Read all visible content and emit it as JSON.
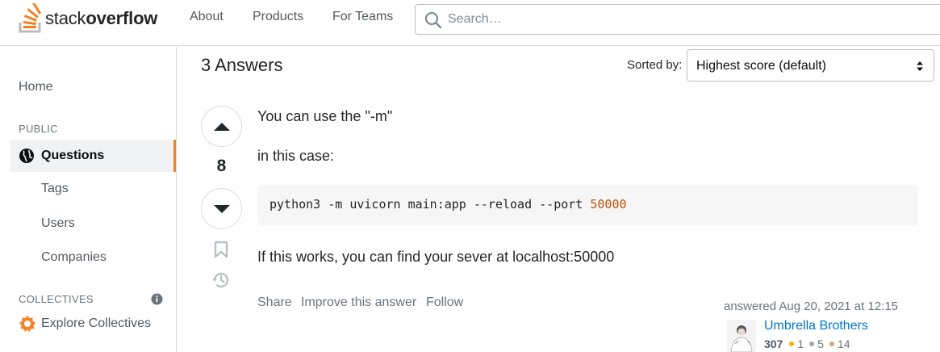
{
  "header": {
    "logo_light": "stack",
    "logo_bold": "overflow",
    "nav": [
      "About",
      "Products",
      "For Teams"
    ],
    "search_placeholder": "Search…"
  },
  "sidebar": {
    "home": "Home",
    "public_section": "PUBLIC",
    "questions": "Questions",
    "tags": "Tags",
    "users": "Users",
    "companies": "Companies",
    "collectives_section": "COLLECTIVES",
    "explore_collectives": "Explore Collectives"
  },
  "answers": {
    "header": "3 Answers",
    "sorted_by_label": "Sorted by:",
    "sort_value": "Highest score (default)"
  },
  "answer": {
    "score": "8",
    "p1": "You can use the \"-m\"",
    "p2": "in this case:",
    "code_text": "python3 -m uvicorn main:app --reload --port ",
    "code_number": "50000",
    "p3": "If this works, you can find your sever at localhost:50000",
    "menu": [
      "Share",
      "Improve this answer",
      "Follow"
    ],
    "answered_label": "answered",
    "answered_time": "Aug 20, 2021 at 12:15",
    "user_name": "Umbrella Brothers",
    "reputation": "307",
    "badges": {
      "gold": "1",
      "silver": "5",
      "bronze": "14"
    }
  },
  "colors": {
    "accent": "#f48225",
    "link": "#0074cc",
    "gold": "#f1b600",
    "silver": "#9fa6ad",
    "bronze": "#d1a684"
  }
}
